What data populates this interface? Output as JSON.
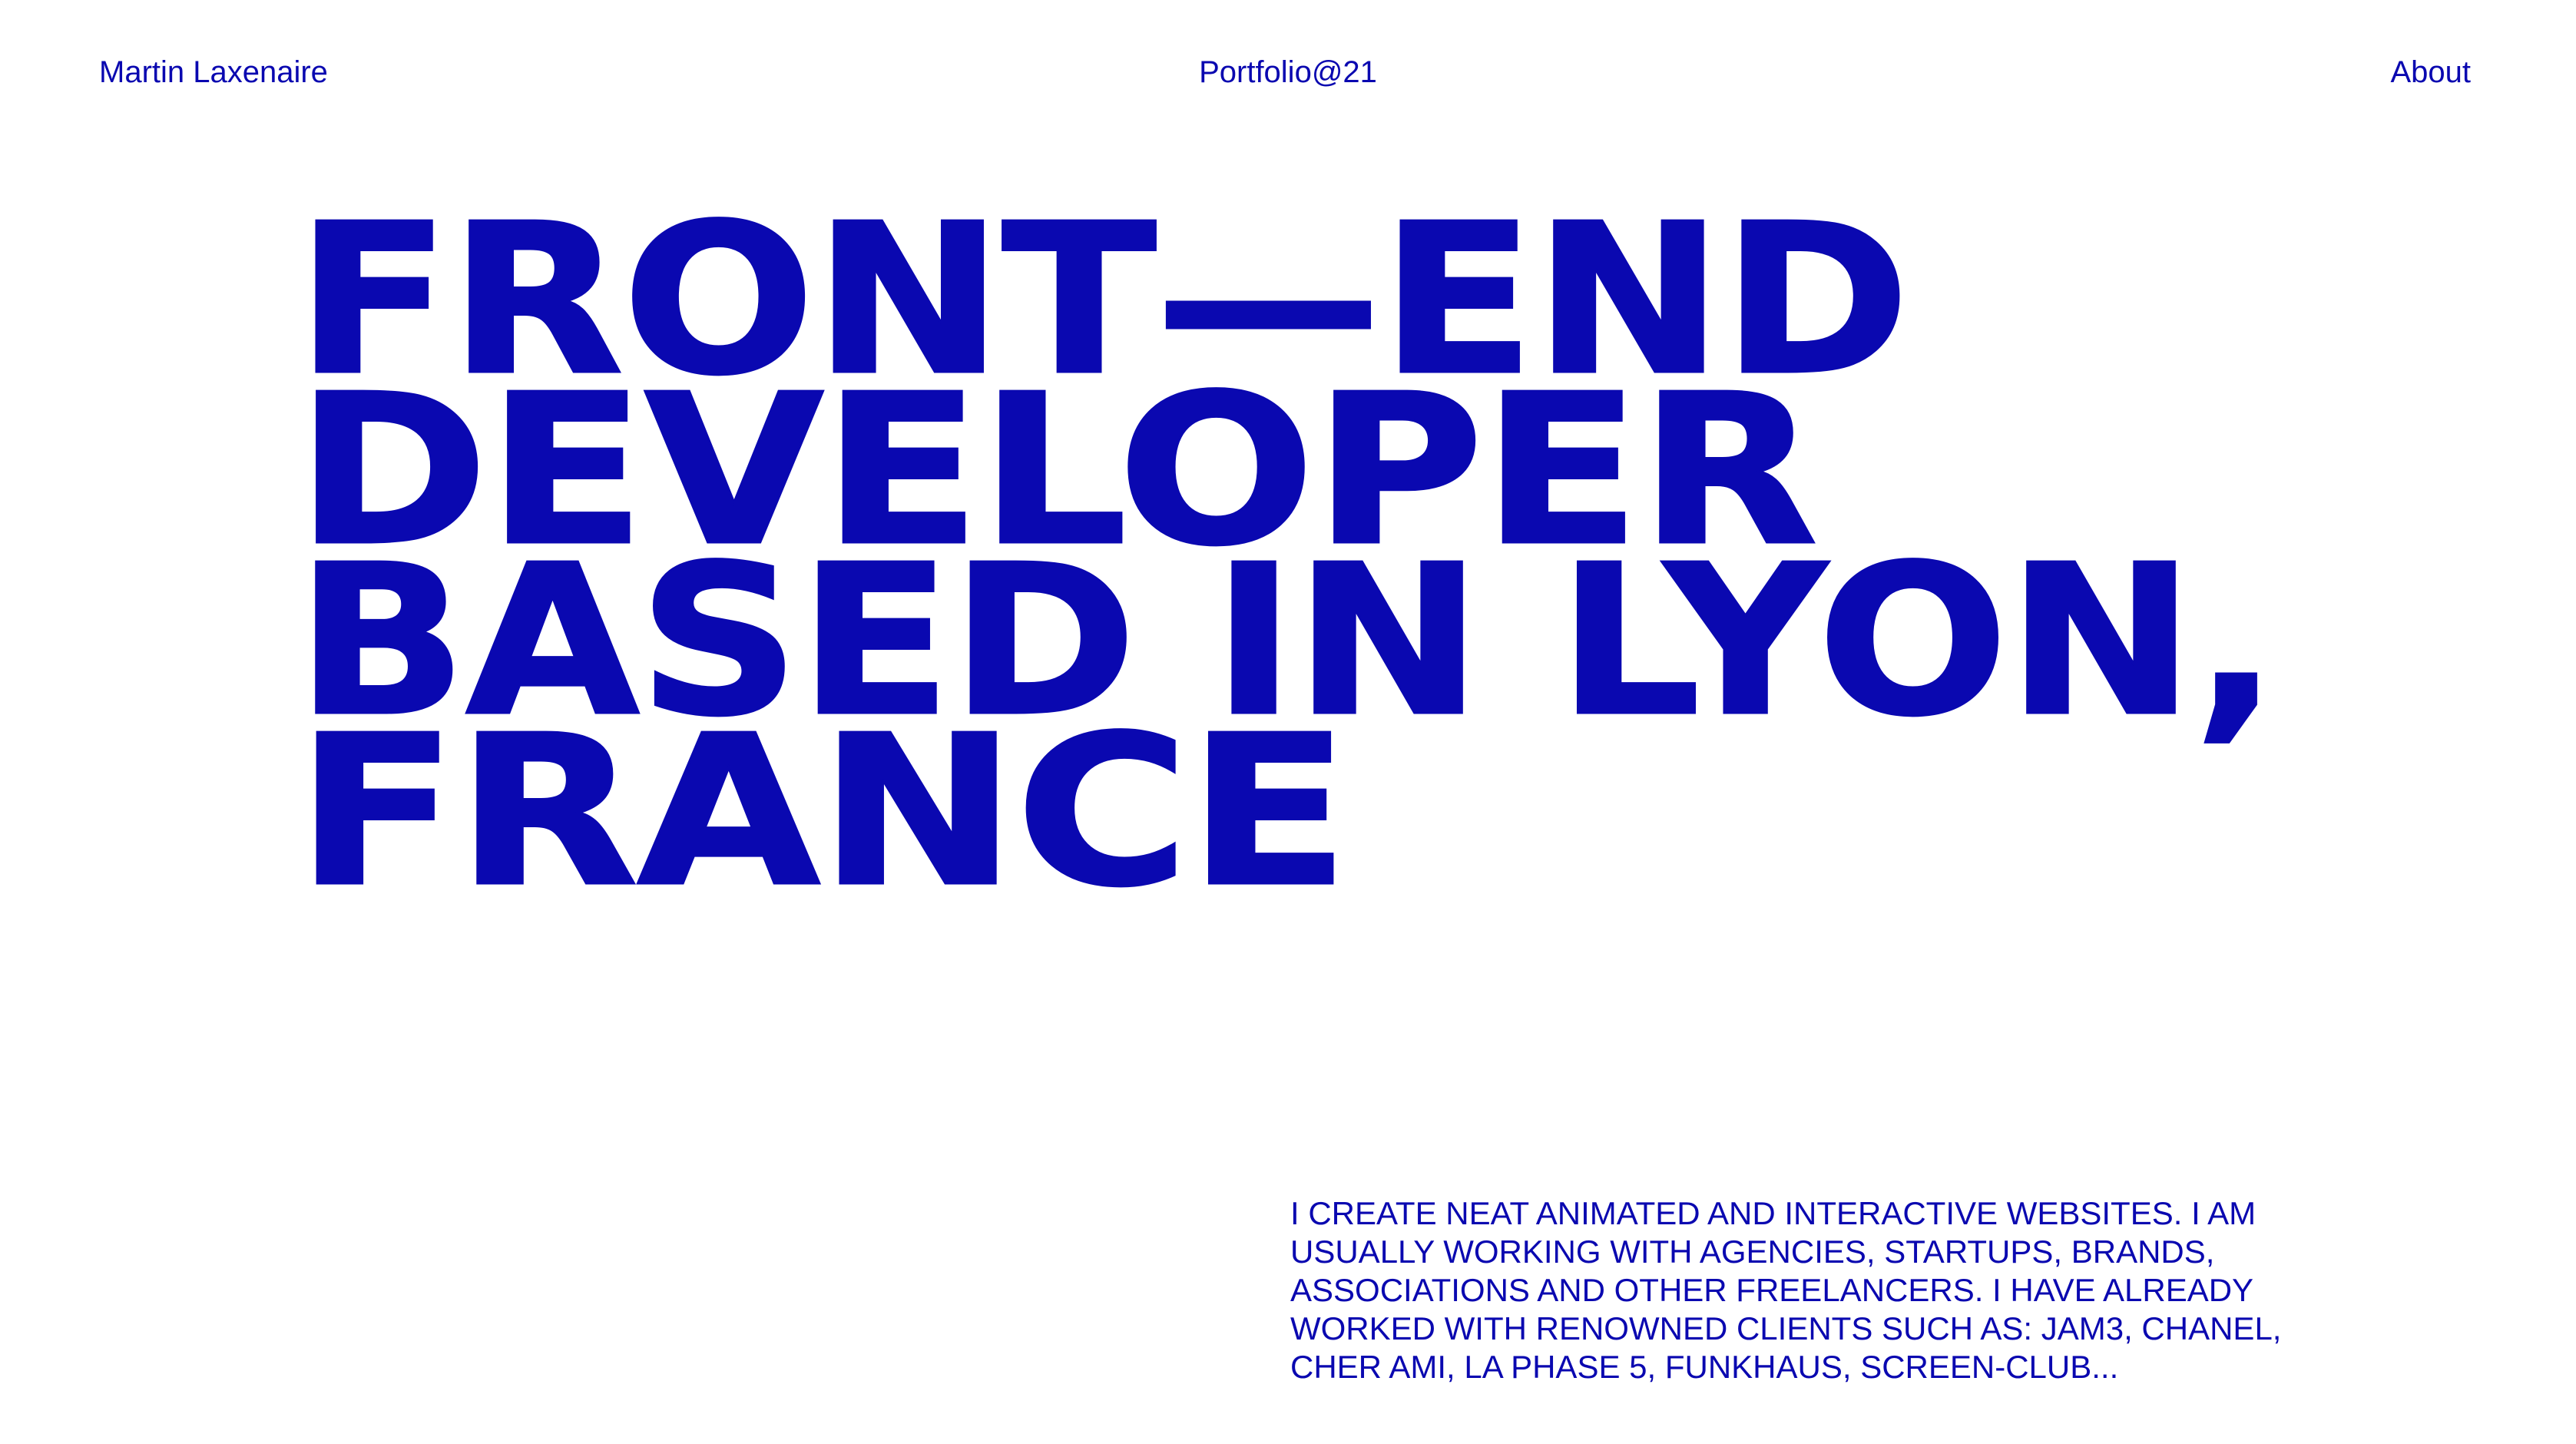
{
  "header": {
    "name": "Martin Laxenaire",
    "portfolio": "Portfolio@21",
    "about": "About"
  },
  "hero": {
    "lines": [
      "FRONT—END",
      "DEVELOPER",
      "BASED IN LYON,",
      "FRANCE"
    ]
  },
  "intro": {
    "text": "I CREATE NEAT ANIMATED AND INTERACTIVE WEBSITES. I AM USUALLY WORKING WITH AGENCIES, STARTUPS, BRANDS, ASSOCIATIONS AND OTHER FREELANCERS. I HAVE ALREADY WORKED WITH RENOWNED CLIENTS SUCH AS: JAM3, CHANEL, CHER AMI, LA PHASE 5, FUNKHAUS, SCREEN-CLUB..."
  },
  "colors": {
    "accent": "#0a08b0",
    "background": "#ffffff"
  }
}
